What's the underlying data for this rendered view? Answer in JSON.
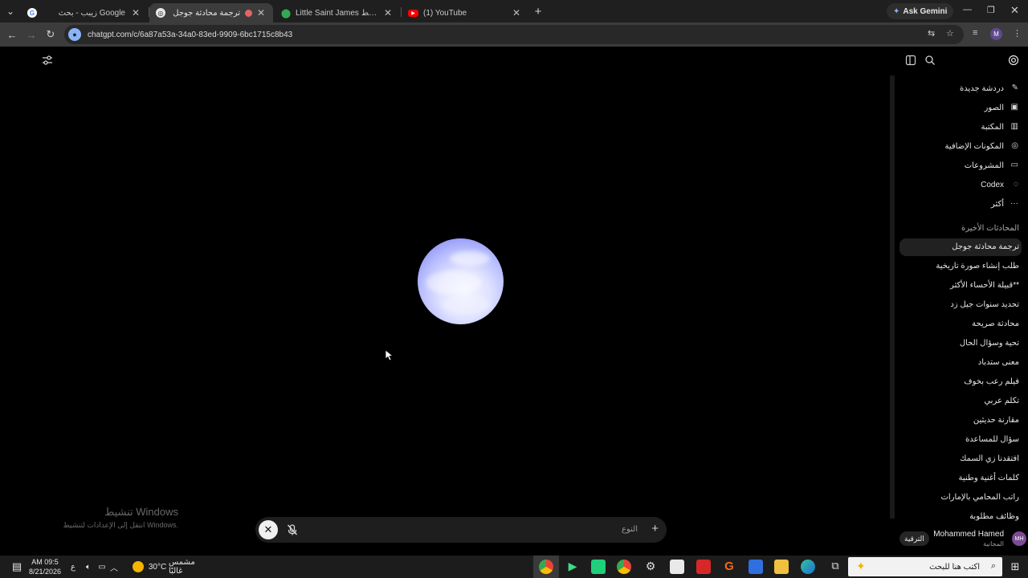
{
  "browser": {
    "tabs": [
      {
        "title": "زيبب - بحث Google",
        "icon": "google-icon",
        "active": false
      },
      {
        "title": "ترجمة محادثة جوجل",
        "icon": "chatgpt-icon",
        "active": true
      },
      {
        "title": "Little Saint James خرائط - Google",
        "icon": "maps-pin-icon",
        "active": false
      },
      {
        "title": "(1) YouTube",
        "icon": "youtube-icon",
        "active": false
      }
    ],
    "ask_gemini": "Ask Gemini",
    "url": "chatgpt.com/c/6a87a53a-34a0-83ed-9909-6bc1715c8b43",
    "profile_initial": "M"
  },
  "chat": {
    "voice_bar": {
      "label": "النوع"
    },
    "watermark": {
      "title": "تنشيط Windows",
      "subtitle": "انتقل إلى الإعدادات لتنشيط Windows."
    }
  },
  "sidebar": {
    "nav": [
      {
        "label": "دردشة جديدة",
        "icon": "edit-icon"
      },
      {
        "label": "الصور",
        "icon": "images-icon"
      },
      {
        "label": "المكتبة",
        "icon": "library-icon"
      },
      {
        "label": "المكونات الإضافية",
        "icon": "plugins-icon"
      },
      {
        "label": "المشروعات",
        "icon": "folder-icon"
      },
      {
        "label": "Codex",
        "icon": "codex-icon"
      },
      {
        "label": "أكثر",
        "icon": "more-icon"
      }
    ],
    "section_title": "المحادثات الأخيرة",
    "chats": [
      "ترجمة محادثة جوجل",
      "طلب إنشاء صورة تاريخية",
      "قبيلة الأحساء الأكثر**",
      "تحديد سنوات جيل زد",
      "محادثة صريحة",
      "تحية وسؤال الحال",
      "معنى ستدباد",
      "فيلم رعب بخوف",
      "تكلم عربي",
      "مقارنة حديثين",
      "سؤال للمساعدة",
      "افتقدنا زي السمك",
      "كلمات أغنية وطنية",
      "راتب المحامي بالإمارات",
      "وظائف مطلوبة"
    ],
    "user": {
      "name": "Mohammed Hamed",
      "plan": "المجانية",
      "initials": "MH",
      "upgrade_label": "الترقية"
    }
  },
  "taskbar": {
    "time": "AM 09:5",
    "date": "8/21/2026",
    "lang": "ع",
    "weather": {
      "temp": "30°C",
      "text": "مشمس غالبًا"
    },
    "search_placeholder": "اكتب هنا للبحث"
  }
}
